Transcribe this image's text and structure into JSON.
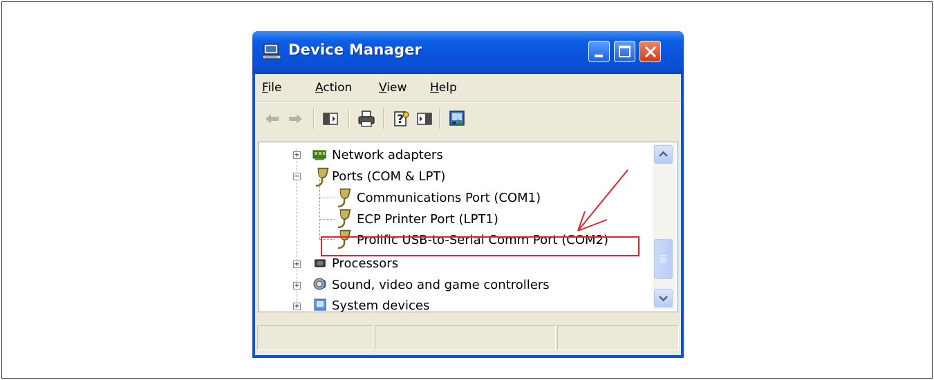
{
  "window": {
    "title": "Device Manager"
  },
  "menu": {
    "file_u": "F",
    "file_rest": "ile",
    "action_u": "A",
    "action_rest": "ction",
    "view_u": "V",
    "view_rest": "iew",
    "help_u": "H",
    "help_rest": "elp"
  },
  "toolbar": {
    "icons": [
      "back-arrow-icon",
      "forward-arrow-icon",
      "show-hide-console-tree-icon",
      "print-icon",
      "help-icon",
      "properties-icon",
      "scan-hardware-icon"
    ]
  },
  "tree": {
    "items": [
      {
        "label": "Network adapters",
        "icon": "network-adapter-icon",
        "expander": "+"
      },
      {
        "label": "Ports (COM & LPT)",
        "icon": "port-icon",
        "expander": "−"
      },
      {
        "label": "Communications Port (COM1)",
        "icon": "port-icon"
      },
      {
        "label": "ECP Printer Port (LPT1)",
        "icon": "port-icon"
      },
      {
        "label": "Prolific USB-to-Serial Comm Port (COM2)",
        "icon": "port-icon"
      },
      {
        "label": "Processors",
        "icon": "processor-icon",
        "expander": "+"
      },
      {
        "label": "Sound, video and game controllers",
        "icon": "speaker-icon",
        "expander": "+"
      },
      {
        "label": "System devices",
        "icon": "system-device-icon",
        "expander": "+"
      }
    ]
  },
  "colors": {
    "titlebar": "#0a54dc",
    "annotation": "#e0262a",
    "window_body": "#ece9d8"
  }
}
